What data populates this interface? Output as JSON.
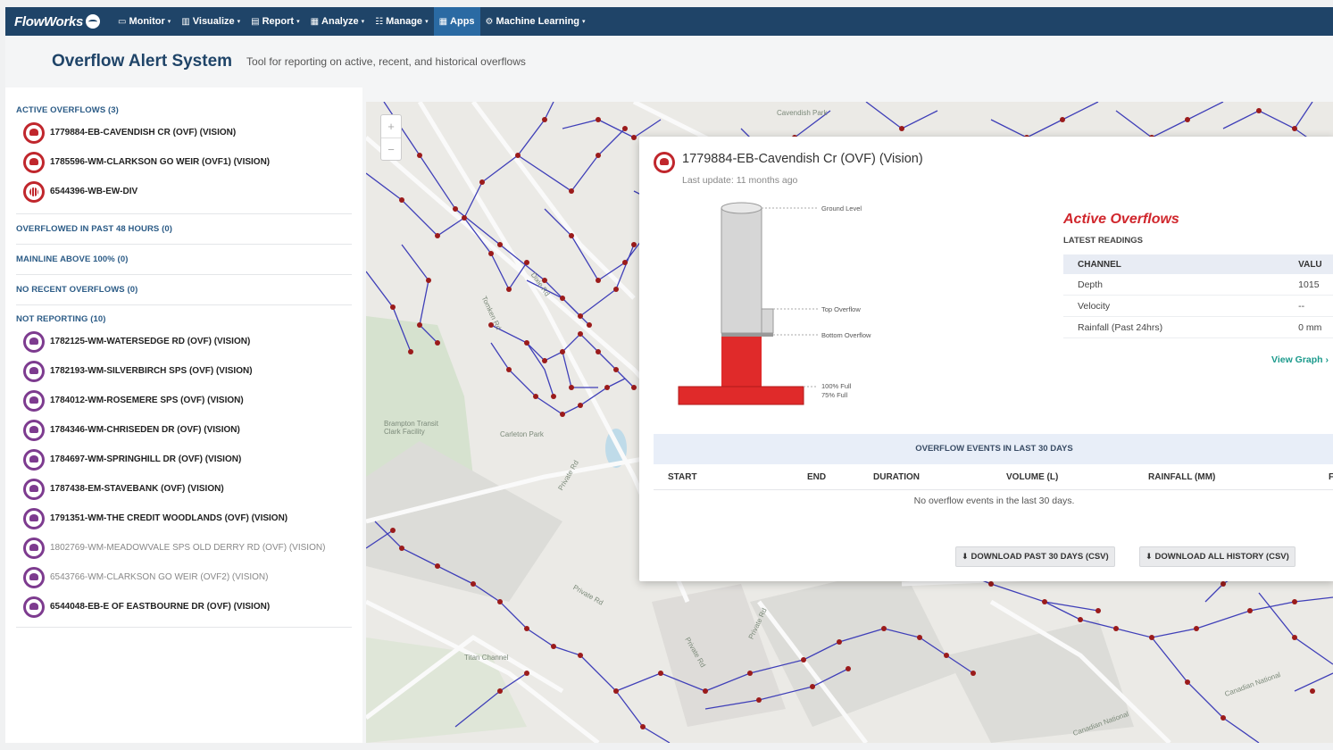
{
  "brand": "FlowWorks",
  "nav": [
    {
      "icon": "monitor-icon",
      "label": "Monitor"
    },
    {
      "icon": "chart-icon",
      "label": "Visualize"
    },
    {
      "icon": "report-icon",
      "label": "Report"
    },
    {
      "icon": "table-icon",
      "label": "Analyze"
    },
    {
      "icon": "sliders-icon",
      "label": "Manage"
    },
    {
      "icon": "grid-icon",
      "label": "Apps",
      "active": true
    },
    {
      "icon": "brain-icon",
      "label": "Machine Learning"
    }
  ],
  "header": {
    "title": "Overflow Alert System",
    "subtitle": "Tool for reporting on active, recent, and historical overflows"
  },
  "sidebar": {
    "active_title": "ACTIVE OVERFLOWS (3)",
    "active_sites": [
      "1779884-EB-CAVENDISH CR (OVF) (VISION)",
      "1785596-WM-CLARKSON GO WEIR (OVF1) (VISION)",
      "6544396-WB-EW-DIV"
    ],
    "past48_title": "OVERFLOWED IN PAST 48 HOURS (0)",
    "mainline_title": "MAINLINE ABOVE 100% (0)",
    "norecent_title": "NO RECENT OVERFLOWS (0)",
    "notreporting_title": "NOT REPORTING (10)",
    "notreporting_sites": [
      "1782125-WM-WATERSEDGE RD (OVF) (VISION)",
      "1782193-WM-SILVERBIRCH SPS (OVF) (VISION)",
      "1784012-WM-ROSEMERE SPS (OVF) (VISION)",
      "1784346-WM-CHRISEDEN DR (OVF) (VISION)",
      "1784697-WM-SPRINGHILL DR (OVF) (VISION)",
      "1787438-EM-STAVEBANK (OVF) (VISION)",
      "1791351-WM-THE CREDIT WOODLANDS (OVF) (VISION)",
      "1802769-WM-MEADOWVALE SPS OLD DERRY RD (OVF) (VISION)",
      "6543766-WM-CLARKSON GO WEIR (OVF2) (VISION)",
      "6544048-EB-E OF EASTBOURNE DR (OVF) (VISION)"
    ]
  },
  "map": {
    "zoom_in": "+",
    "zoom_out": "−",
    "labels": [
      "Cavendish Park",
      "Carleton Park",
      "Brampton Transit Clark Facility",
      "Titan Channel",
      "Canadian National",
      "Canadian National"
    ],
    "streets": [
      "Dixie Rd",
      "Tomken Rd",
      "Private Rd",
      "Private Rd",
      "Private Rd",
      "Private Rd"
    ]
  },
  "popup": {
    "title": "1779884-EB-Cavendish Cr (OVF) (Vision)",
    "last_update": "Last update: 11 months ago",
    "gauge_labels": {
      "ground": "Ground Level",
      "top": "Top Overflow",
      "bottom": "Bottom Overflow",
      "full100": "100% Full",
      "full75": "75% Full"
    },
    "active_overflows": "Active Overflows",
    "latest_readings": "LATEST READINGS",
    "columns": {
      "channel": "CHANNEL",
      "value": "VALU"
    },
    "readings": [
      {
        "channel": "Depth",
        "value": "1015"
      },
      {
        "channel": "Velocity",
        "value": "--"
      },
      {
        "channel": "Rainfall (Past 24hrs)",
        "value": "0 mm"
      }
    ],
    "view_graph": "View Graph ›",
    "events_title": "OVERFLOW EVENTS IN LAST 30 DAYS",
    "events_columns": [
      "START",
      "END",
      "DURATION",
      "VOLUME (L)",
      "RAINFALL (MM)",
      "F"
    ],
    "no_events": "No overflow events in the last 30 days.",
    "download_30": "DOWNLOAD PAST 30 DAYS (CSV)",
    "download_all": "DOWNLOAD ALL HISTORY (CSV)"
  },
  "colors": {
    "navbar": "#1f4468",
    "nav_active": "#2a6aa3",
    "active_red": "#c0262c",
    "not_reporting_purple": "#7d3b8f",
    "pipe_blue": "#3f3fb8",
    "node_red": "#9b1b1b",
    "gauge_red": "#e02a2a",
    "gauge_gray": "#d6d6d6",
    "view_graph_teal": "#1b9a8c"
  }
}
